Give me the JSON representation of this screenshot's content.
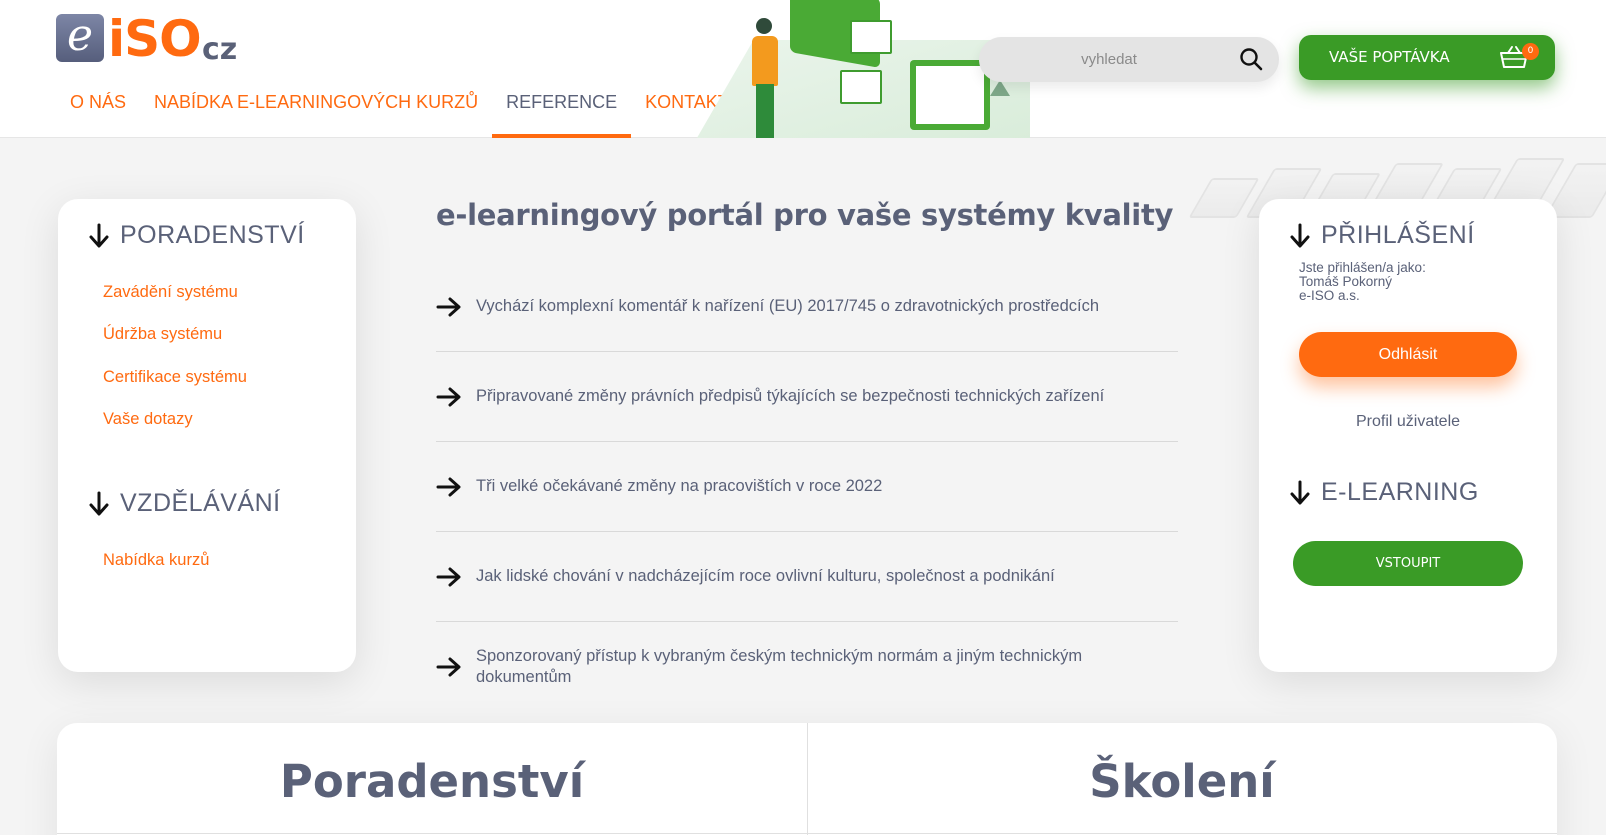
{
  "brand": {
    "logo_e": "e",
    "logo_iso": "iSO",
    "logo_cz": "cz"
  },
  "nav": [
    {
      "label": "O NÁS",
      "active": false
    },
    {
      "label": "NABÍDKA E-LEARNINGOVÝCH KURZŮ",
      "active": false
    },
    {
      "label": "REFERENCE",
      "active": true
    },
    {
      "label": "KONTAKTY",
      "active": false
    }
  ],
  "search": {
    "placeholder": "vyhledat",
    "icon": "search-icon"
  },
  "order": {
    "label": "VAŠE POPTÁVKA",
    "count": "0",
    "icon": "cart-icon"
  },
  "left": {
    "consulting_title": "PORADENSTVÍ",
    "consulting_links": [
      "Zavádění systému",
      "Údržba systému",
      "Certifikace systému",
      "Vaše dotazy"
    ],
    "education_title": "VZDĚLÁVÁNÍ",
    "education_links": [
      "Nabídka kurzů"
    ]
  },
  "main": {
    "title": "e-learningový portál pro vaše systémy kvality",
    "news": [
      "Vychází komplexní komentář k nařízení (EU) 2017/745 o zdravotnických prostředcích",
      "Připravované změny právních předpisů týkajících se bezpečnosti technických zařízení",
      "Tři velké očekávané změny na pracovištích v roce 2022",
      "Jak lidské chování v nadcházejícím roce ovlivní kulturu, společnost a podnikání",
      "Sponzorovaný přístup k vybraným českým technickým normám a jiným technickým dokumentům"
    ]
  },
  "right": {
    "login_title": "PŘIHLÁŠENÍ",
    "logged_as": "Jste přihlášen/a jako:",
    "user_name": "Tomáš Pokorný",
    "company": "e-ISO a.s.",
    "logout": "Odhlásit",
    "profile": "Profil uživatele",
    "elearning_title": "E-LEARNING",
    "enter": "VSTOUPIT"
  },
  "bottom": {
    "left_title": "Poradenství",
    "right_title": "Školení"
  },
  "colors": {
    "orange": "#ff6a10",
    "green": "#3a9b26",
    "slate": "#5a6178"
  }
}
